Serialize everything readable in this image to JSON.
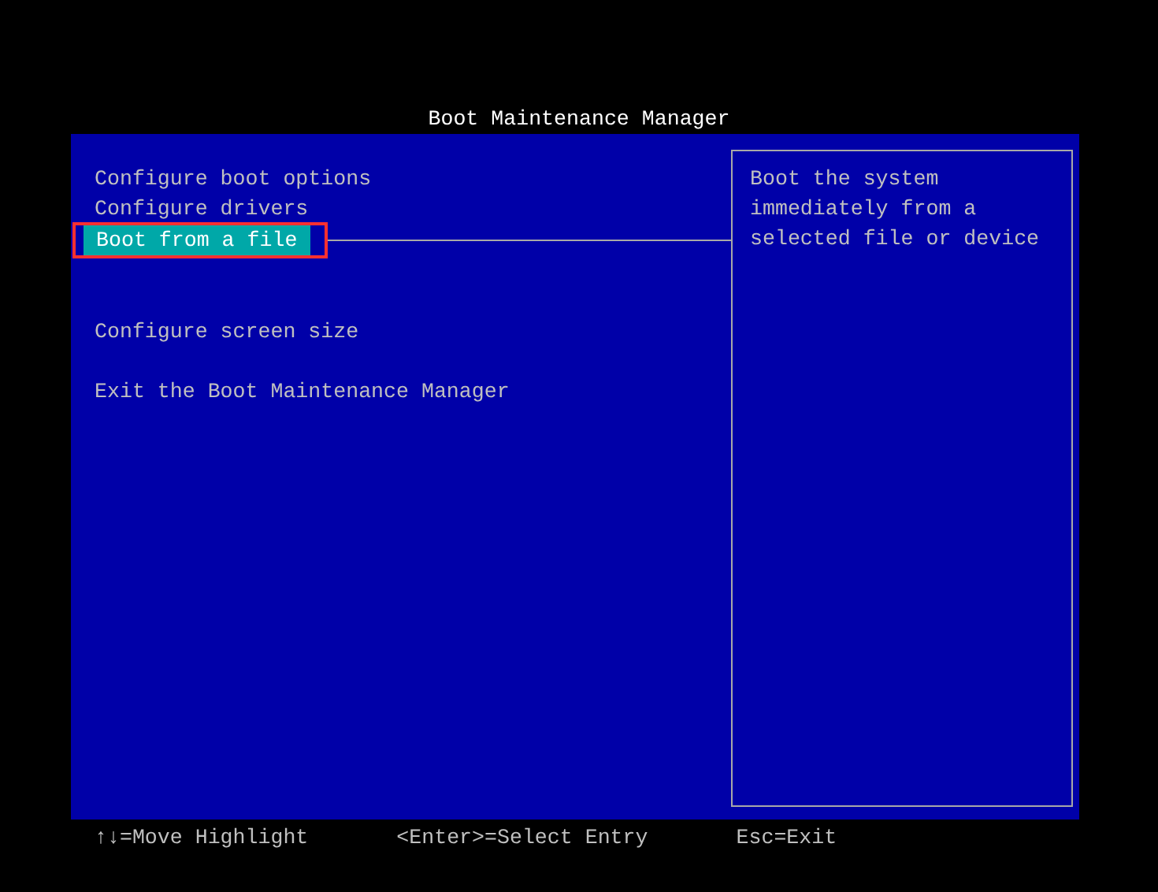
{
  "title": "Boot Maintenance Manager",
  "menu": [
    {
      "label": "Configure boot options",
      "selected": false
    },
    {
      "label": "Configure drivers",
      "selected": false
    },
    {
      "label": "Boot from a file",
      "selected": true
    },
    {
      "label": "Configure screen size",
      "selected": false
    },
    {
      "label": "Exit the Boot Maintenance Manager",
      "selected": false
    }
  ],
  "help": [
    "Boot the system",
    "immediately from a",
    "selected file or device"
  ],
  "footer": [
    "↑↓=Move Highlight",
    "<Enter>=Select Entry",
    "Esc=Exit"
  ]
}
